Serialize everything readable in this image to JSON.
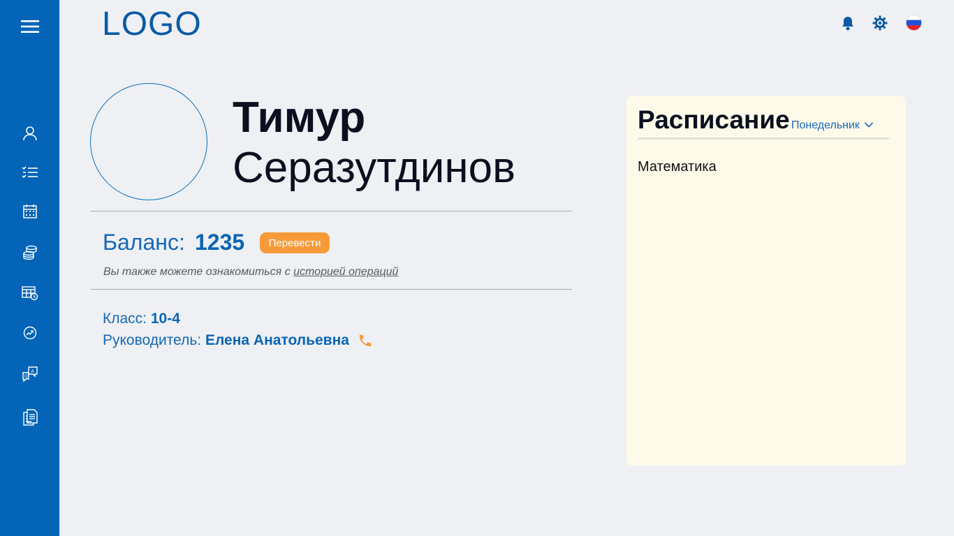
{
  "header": {
    "logo": "LOGO"
  },
  "sidebar": {
    "items": [
      {
        "icon": "menu-icon"
      },
      {
        "icon": "profile-icon"
      },
      {
        "icon": "tasks-icon"
      },
      {
        "icon": "calendar-icon"
      },
      {
        "icon": "coins-icon"
      },
      {
        "icon": "schedule-grid-icon"
      },
      {
        "icon": "analytics-icon"
      },
      {
        "icon": "chat-icon"
      },
      {
        "icon": "documents-icon"
      }
    ]
  },
  "topbar": {
    "icons": [
      "bell-icon",
      "settings-icon",
      "russia-flag-icon"
    ]
  },
  "profile": {
    "first_name": "Тимур",
    "last_name": "Серазутдинов"
  },
  "balance": {
    "label": "Баланс:",
    "value": "1235",
    "transfer_label": "Перевести",
    "hint_prefix": "Вы также можете ознакомиться с ",
    "hint_link": "историей операций"
  },
  "info": {
    "class_label": "Класс:",
    "class_value": "10-4",
    "leader_label": "Руководитель:",
    "leader_value": "Елена Анатольевна"
  },
  "schedule": {
    "title": "Расписание",
    "day": "Понедельник",
    "subjects": [
      "Математика"
    ]
  },
  "colors": {
    "sidebar": "#0364b8",
    "accent_orange": "#f79a3a",
    "panel": "#fdfaea",
    "background": "#eef0f3"
  }
}
